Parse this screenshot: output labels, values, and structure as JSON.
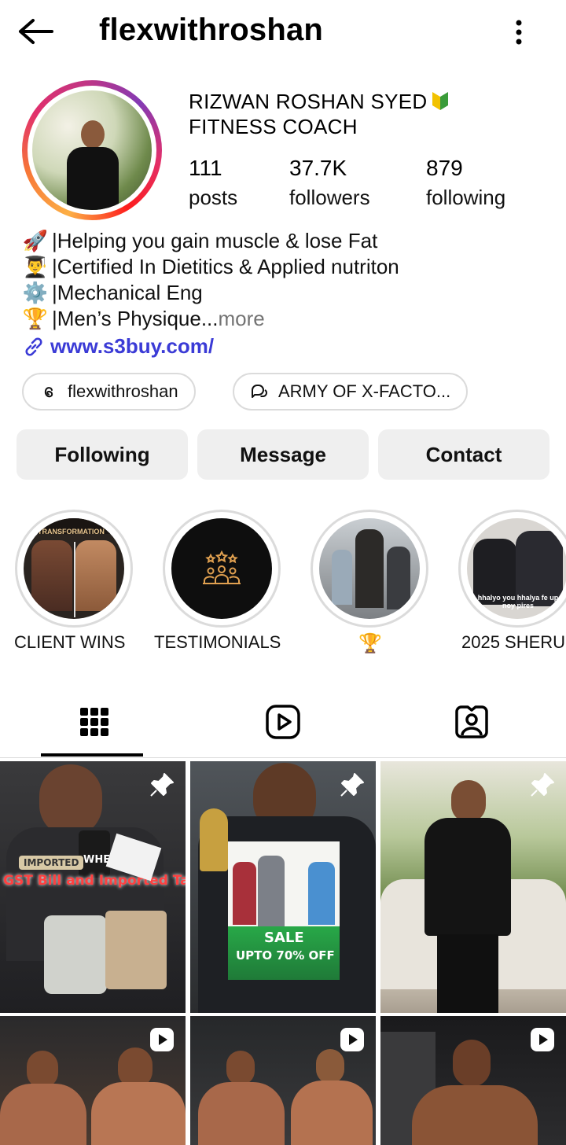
{
  "header": {
    "username": "flexwithroshan",
    "back_icon": "arrow-left-icon",
    "menu_icon": "kebab-menu-icon"
  },
  "profile": {
    "name_line1": "RIZWAN ROSHAN SYED",
    "name_badge_icon": "beginner-badge-icon",
    "name_line2": "FITNESS COACH",
    "stats": [
      {
        "value": "111",
        "label": "posts"
      },
      {
        "value": "37.7K",
        "label": "followers"
      },
      {
        "value": "879",
        "label": "following"
      }
    ]
  },
  "bio": {
    "lines": [
      {
        "emoji": "🚀",
        "text": "|Helping you gain muscle & lose Fat"
      },
      {
        "emoji": "👨‍🎓",
        "text": "|Certified In Dietitics & Applied nutriton"
      },
      {
        "emoji": "⚙️",
        "text": "|Mechanical Eng"
      },
      {
        "emoji": "🏆",
        "text": "|Men’s Physique..."
      }
    ],
    "more": " more",
    "link": "www.s3buy.com/"
  },
  "chips": [
    {
      "icon": "threads-icon",
      "label": "flexwithroshan"
    },
    {
      "icon": "chat-bubble-icon",
      "label": "ARMY OF X-FACTO..."
    }
  ],
  "actions": {
    "following": "Following",
    "message": "Message",
    "contact": "Contact"
  },
  "highlights": [
    {
      "label": "CLIENT WINS",
      "caption": "TRANSFORMATION"
    },
    {
      "label": "TESTIMONIALS"
    },
    {
      "label": "🏆"
    },
    {
      "label": "2025 SHERU",
      "caption": "hhalyo you hhalya fe up noy pires"
    }
  ],
  "tabs": [
    {
      "name": "grid",
      "icon": "grid-icon"
    },
    {
      "name": "reels",
      "icon": "reels-icon"
    },
    {
      "name": "tagged",
      "icon": "tagged-person-icon"
    }
  ],
  "posts": [
    {
      "badge": "pin-icon",
      "overlay_text": "GST Bill and Imported Tag",
      "tag": "IMPORTED",
      "label": "WHEY"
    },
    {
      "badge": "pin-icon",
      "overlay_text": "SALE",
      "discount": "UPTO 70% OFF"
    },
    {
      "badge": "pin-icon"
    },
    {
      "badge": "reel-play-icon"
    },
    {
      "badge": "reel-play-icon"
    },
    {
      "badge": "reel-play-icon"
    }
  ],
  "colors": {
    "link": "#3b3bd6",
    "muted": "#737373",
    "button_bg": "#efefef",
    "border": "#dbdbdb"
  }
}
